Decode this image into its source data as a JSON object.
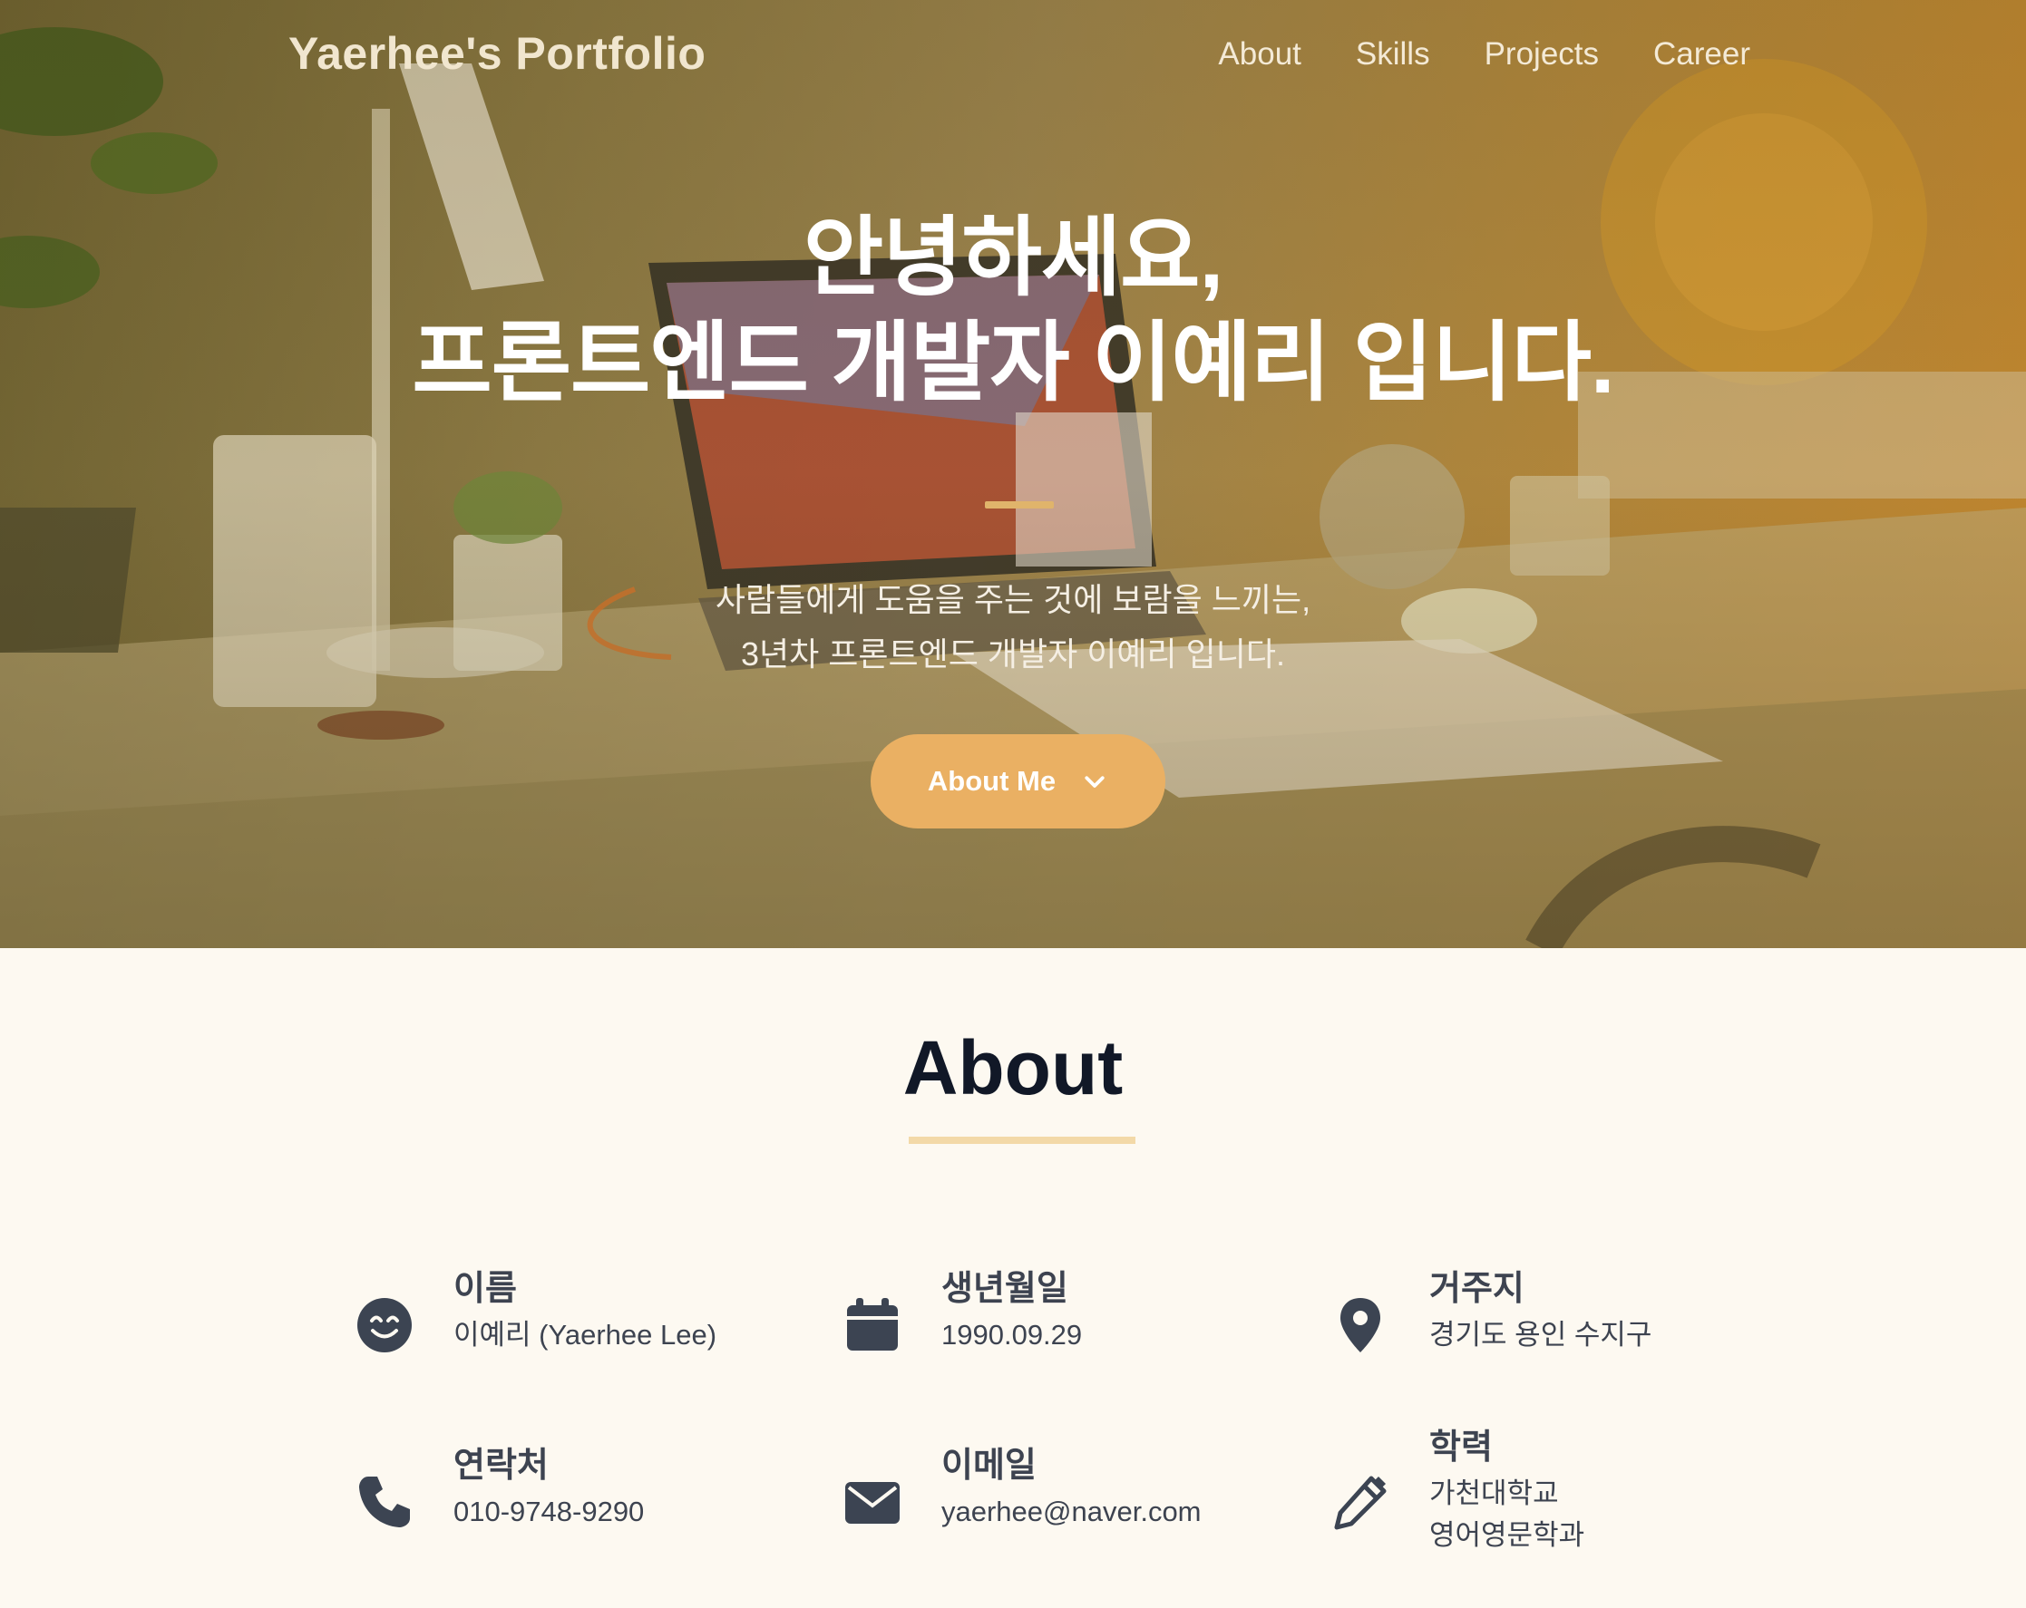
{
  "header": {
    "logo": "Yaerhee's Portfolio",
    "nav": [
      "About",
      "Skills",
      "Projects",
      "Career"
    ]
  },
  "hero": {
    "title_line1": "안녕하세요,",
    "title_line2": "프론트엔드 개발자 이예리 입니다.",
    "subtitle_line1": "사람들에게 도움을 주는 것에 보람을 느끼는,",
    "subtitle_line2": "3년차 프론트엔드 개발자 이예리 입니다.",
    "cta_label": "About Me"
  },
  "about": {
    "title": "About",
    "items": [
      {
        "icon": "smile-icon",
        "label": "이름",
        "value": "이예리 (Yaerhee Lee)"
      },
      {
        "icon": "calendar-icon",
        "label": "생년월일",
        "value": "1990.09.29"
      },
      {
        "icon": "map-pin-icon",
        "label": "거주지",
        "value": "경기도 용인 수지구"
      },
      {
        "icon": "phone-icon",
        "label": "연락처",
        "value": "010-9748-9290"
      },
      {
        "icon": "envelope-icon",
        "label": "이메일",
        "value": "yaerhee@naver.com"
      },
      {
        "icon": "pencil-icon",
        "label": "학력",
        "value_line1": "가천대학교",
        "value_line2": "영어영문학과"
      }
    ]
  },
  "colors": {
    "accent": "#eab063",
    "underline": "#f3d9a8",
    "page_bg": "#fdf9f1",
    "text_dark": "#111827"
  }
}
